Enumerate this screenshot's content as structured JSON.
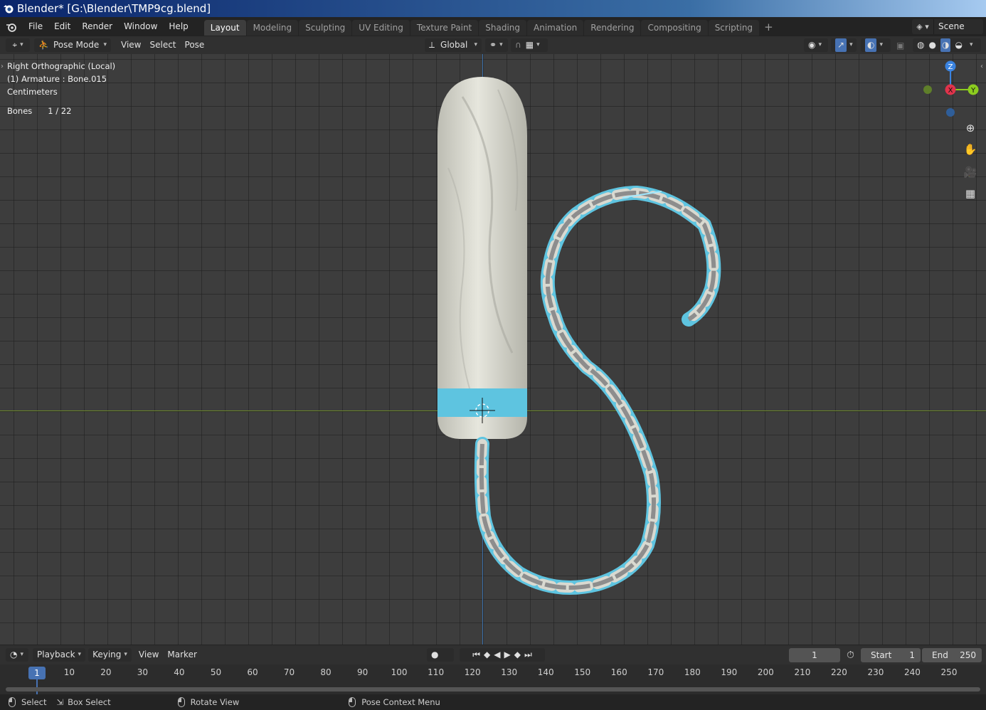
{
  "window": {
    "title": "Blender* [G:\\Blender\\TMP9cg.blend]"
  },
  "menu": [
    "File",
    "Edit",
    "Render",
    "Window",
    "Help"
  ],
  "workspaces": [
    "Layout",
    "Modeling",
    "Sculpting",
    "UV Editing",
    "Texture Paint",
    "Shading",
    "Animation",
    "Rendering",
    "Compositing",
    "Scripting"
  ],
  "active_workspace": "Layout",
  "scene": {
    "name": "Scene"
  },
  "viewport_header": {
    "mode": "Pose Mode",
    "menus": [
      "View",
      "Select",
      "Pose"
    ],
    "orientation": "Global"
  },
  "viewport": {
    "view_name": "Right Orthographic (Local)",
    "object_info": "(1) Armature : Bone.015",
    "units": "Centimeters",
    "stats_label": "Bones",
    "stats_value": "1 / 22",
    "gizmo": {
      "z": "Z",
      "x": "X",
      "y": "Y"
    }
  },
  "timeline": {
    "menus": [
      "Playback",
      "Keying",
      "View",
      "Marker"
    ],
    "current_frame": "1",
    "start_label": "Start",
    "start_value": "1",
    "end_label": "End",
    "end_value": "250",
    "ticks": [
      "10",
      "20",
      "30",
      "40",
      "50",
      "60",
      "70",
      "80",
      "90",
      "100",
      "110",
      "120",
      "130",
      "140",
      "150",
      "160",
      "170",
      "180",
      "190",
      "200",
      "210",
      "220",
      "230",
      "240",
      "250"
    ],
    "playhead_label": "1"
  },
  "statusbar": {
    "select": "Select",
    "box_select": "Box Select",
    "rotate_view": "Rotate View",
    "context_menu": "Pose Context Menu"
  },
  "colors": {
    "accent": "#4772b3",
    "x_axis": "#e0334b",
    "y_axis": "#8ccc1f",
    "z_axis": "#3a83e0",
    "string_blue": "#5ec4e0"
  }
}
